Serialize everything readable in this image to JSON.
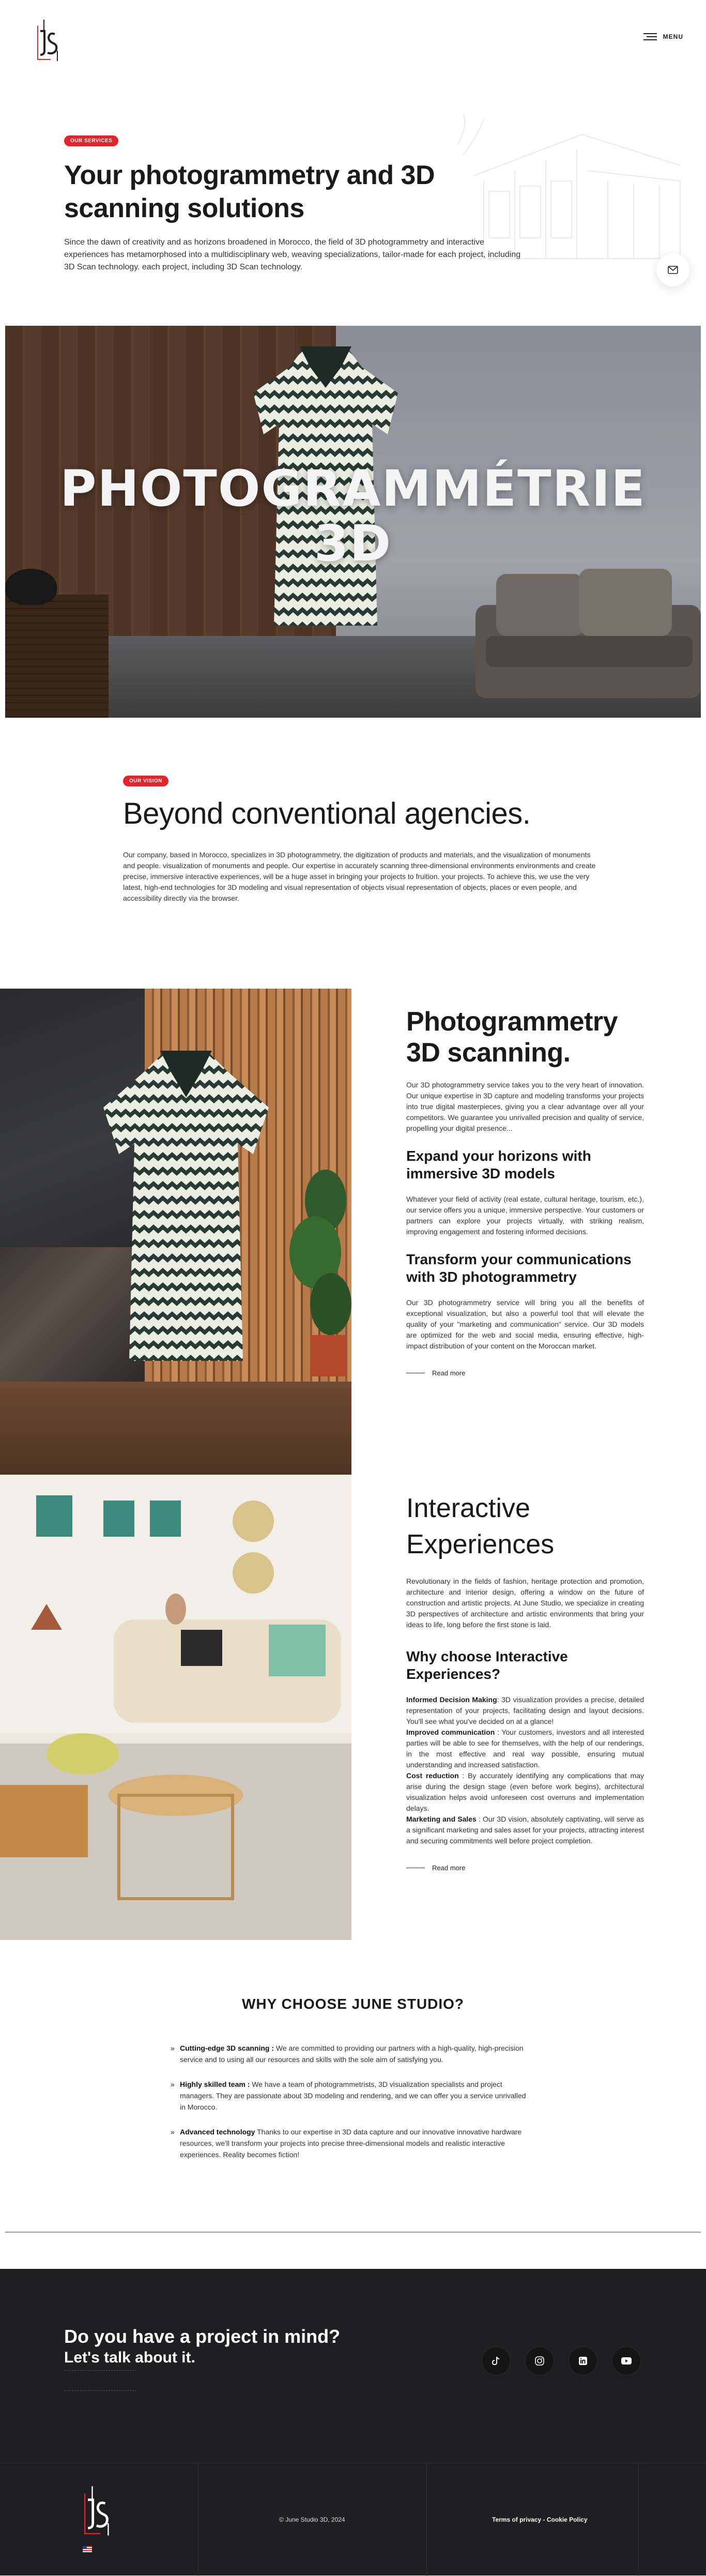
{
  "header": {
    "logo_alt": "JS",
    "menu_label": "MENU"
  },
  "services": {
    "badge": "OUR SERVICES",
    "title": "Your photogrammetry and 3D scanning solutions",
    "paragraph": "Since the dawn of creativity and as horizons broadened in Morocco, the field of 3D photogrammetry and interactive experiences has metamorphosed into a multidisciplinary web, weaving specializations, tailor-made for each project, including 3D Scan technology. each project, including 3D Scan technology."
  },
  "hero": {
    "title_line1": "PHOTOGRAMMÉTRIE",
    "title_line2": "3D"
  },
  "vision": {
    "badge": "OUR VISION",
    "title": "Beyond conventional agencies.",
    "paragraph": "Our company, based in Morocco, specializes in 3D photogrammetry, the digitization of products and materials, and the visualization of monuments and people. visualization of monuments and people. Our expertise in accurately scanning three-dimensional environments environments and create precise, immersive interactive experiences, will be a huge asset in bringing your projects to fruition. your projects. To achieve this, we use the very latest, high-end technologies for 3D modeling and visual representation of objects visual representation of objects, places or even people, and accessibility directly via the browser."
  },
  "photogrammetry": {
    "title": "Photogrammetry 3D scanning.",
    "intro": "Our 3D photogrammetry service takes you to the very heart of innovation. Our unique expertise in 3D capture and modeling transforms your projects into true digital masterpieces, giving you a clear advantage over all your competitors. We guarantee you unrivalled precision and quality of service, propelling your digital presence...",
    "h_expand": "Expand your horizons with immersive 3D models",
    "p_expand": "Whatever your field of activity (real estate, cultural heritage, tourism, etc.), our service offers you a unique, immersive perspective. Your customers or partners can explore your projects virtually, with striking realism, improving engagement and fostering informed decisions.",
    "h_transform": "Transform your communications with 3D photogrammetry",
    "p_transform": "Our 3D photogrammetry service will bring you all the benefits of exceptional visualization, but also a powerful tool that will elevate the quality of your \"marketing and communication\" service. Our 3D models are optimized for the web and social media, ensuring effective, high-impact distribution of your content on the Moroccan market.",
    "read_more": "Read more"
  },
  "interactive": {
    "title": "Interactive Experiences",
    "intro": "Revolutionary in the fields of fashion, heritage protection and promotion, architecture and interior design, offering a window on the future of construction and artistic projects. At June Studio, we specialize in creating 3D perspectives of architecture and artistic environments that bring your ideas to life, long before the first stone is laid.",
    "why_title": "Why choose Interactive Experiences?",
    "points": [
      {
        "label": "Informed Decision Making",
        "text": ": 3D visualization provides a precise, detailed representation of your projects, facilitating design and layout decisions. You'll see what you've decided on at a glance!"
      },
      {
        "label": "Improved communication",
        "text": " : Your customers, investors and all interested parties will be able to see for themselves, with the help of our renderings, in the most effective and real way possible, ensuring mutual understanding and increased satisfaction."
      },
      {
        "label": "Cost reduction",
        "text": " : By accurately identifying any complications that may arise during the design stage (even before work begins), architectural visualization helps avoid unforeseen cost overruns and implementation delays."
      },
      {
        "label": "Marketing and Sales",
        "text": " : Our 3D vision, absolutely captivating, will serve as a significant marketing and sales asset for your projects, attracting interest and securing commitments well before project completion."
      }
    ],
    "read_more": "Read more"
  },
  "why": {
    "title": "WHY CHOOSE JUNE STUDIO?",
    "items": [
      {
        "label": "Cutting-edge 3D scanning :",
        "text": " We are committed to providing our partners with a high-quality, high-precision service and to using all our resources and skills with the sole aim of satisfying you."
      },
      {
        "label": "Highly skilled team :",
        "text": " We have a team of photogrammetrists, 3D visualization specialists and project managers. They are passionate about 3D modeling and rendering, and we can offer you a service unrivalled in Morocco."
      },
      {
        "label": "Advanced technology",
        "text": " Thanks to our expertise in 3D data capture and our innovative innovative hardware resources, we'll transform your projects into precise three-dimensional models and realistic interactive experiences. Reality becomes fiction!"
      }
    ]
  },
  "cta": {
    "title": "Do you have a project in mind?",
    "subtitle": "Let's talk about it.",
    "socials": [
      "tiktok-icon",
      "instagram-icon",
      "linkedin-icon",
      "youtube-icon"
    ]
  },
  "footer": {
    "copyright": "© June Studio 3D, 2024",
    "terms": "Terms of privacy",
    "separator": " - ",
    "cookie": "Cookie Policy"
  },
  "colors": {
    "accent": "#e3242b",
    "dark": "#1f1f21"
  }
}
